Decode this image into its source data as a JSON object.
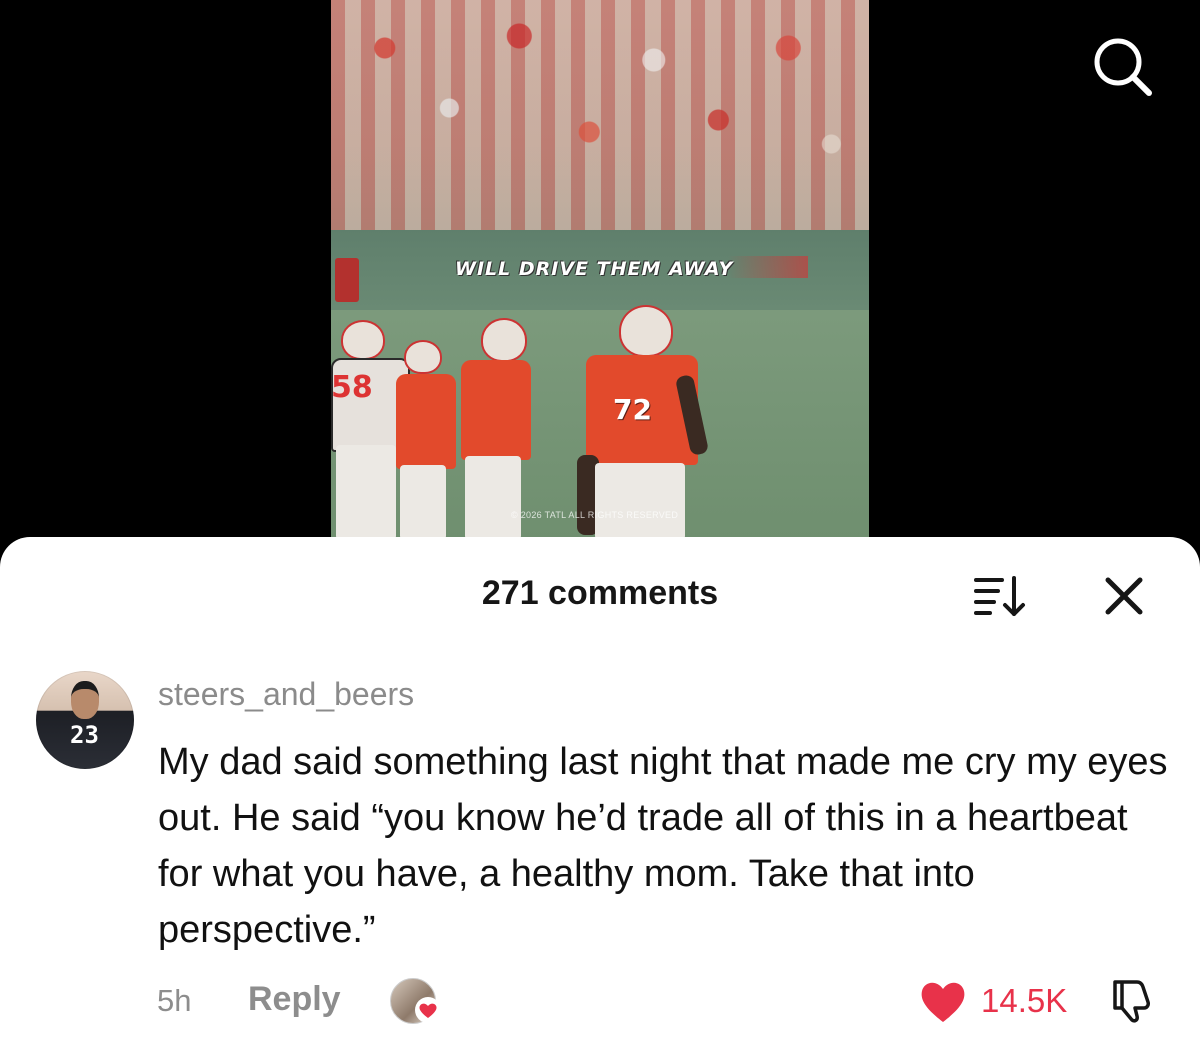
{
  "video": {
    "caption": "WILL DRIVE THEM AWAY",
    "jersey_number": "72",
    "left_number": "58",
    "watermark": "© 2026 TATL ALL RIGHTS RESERVED"
  },
  "header": {
    "search_icon": "search-icon"
  },
  "comments_sheet": {
    "title": "271 comments",
    "sort_icon": "sort-icon",
    "close_icon": "close-icon"
  },
  "comment": {
    "avatar_number": "23",
    "username": "steers_and_beers",
    "text": "My dad said something last night that made me cry my eyes out. He said “you know he’d trade all of this in a heartbeat for what you have, a healthy mom. Take that into perspective.”",
    "time": "5h",
    "reply_label": "Reply",
    "like_count": "14.5K",
    "liked": true,
    "like_color": "#e8324a"
  }
}
